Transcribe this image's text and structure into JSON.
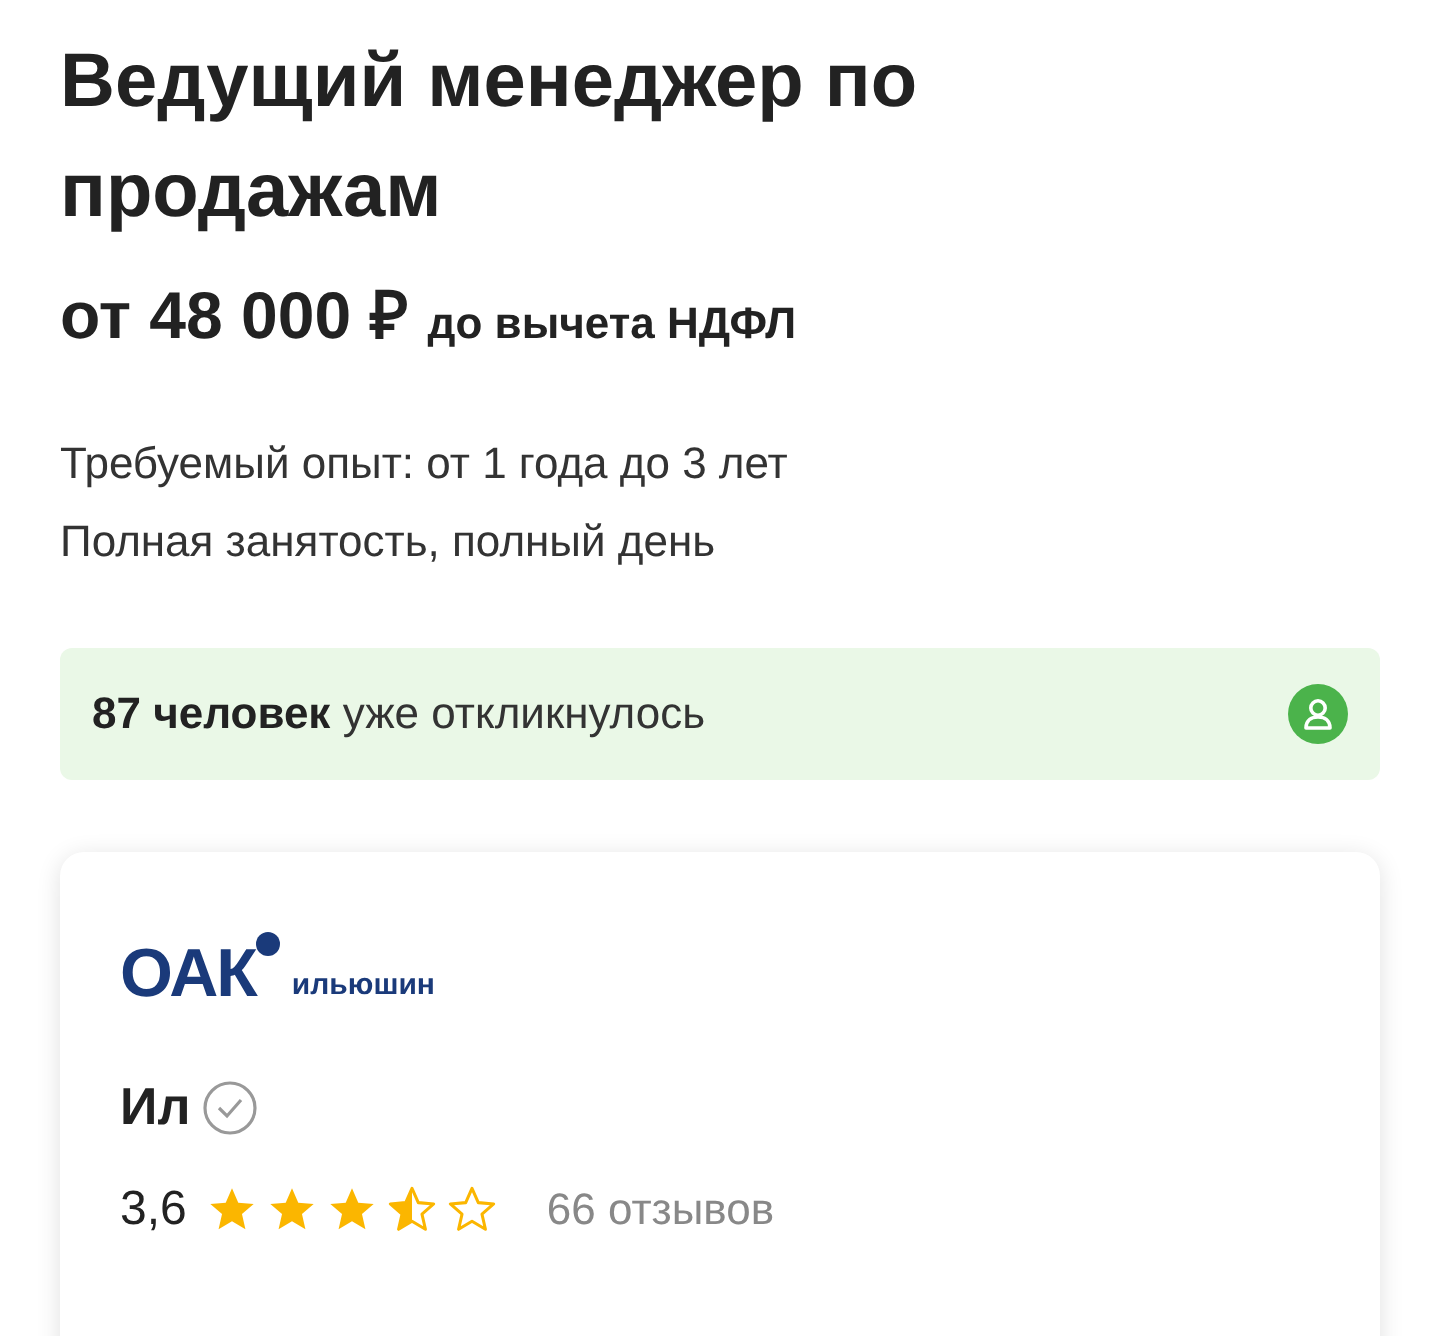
{
  "vacancy": {
    "title": "Ведущий менеджер по продажам",
    "salary": "от 48 000 ₽",
    "salary_note": "до вычета НДФЛ",
    "details": [
      "Требуемый опыт: от 1 года до 3 лет",
      "Полная занятость, полный день"
    ]
  },
  "responses": {
    "text": "**87 человек** уже откликнулось"
  },
  "company": {
    "logo_mark": "ОАК",
    "logo_name": "ильюшин",
    "name": "Ил",
    "verified": true,
    "rating": "3,6",
    "stars": 3.5,
    "reviews": "66 отзывов"
  }
}
